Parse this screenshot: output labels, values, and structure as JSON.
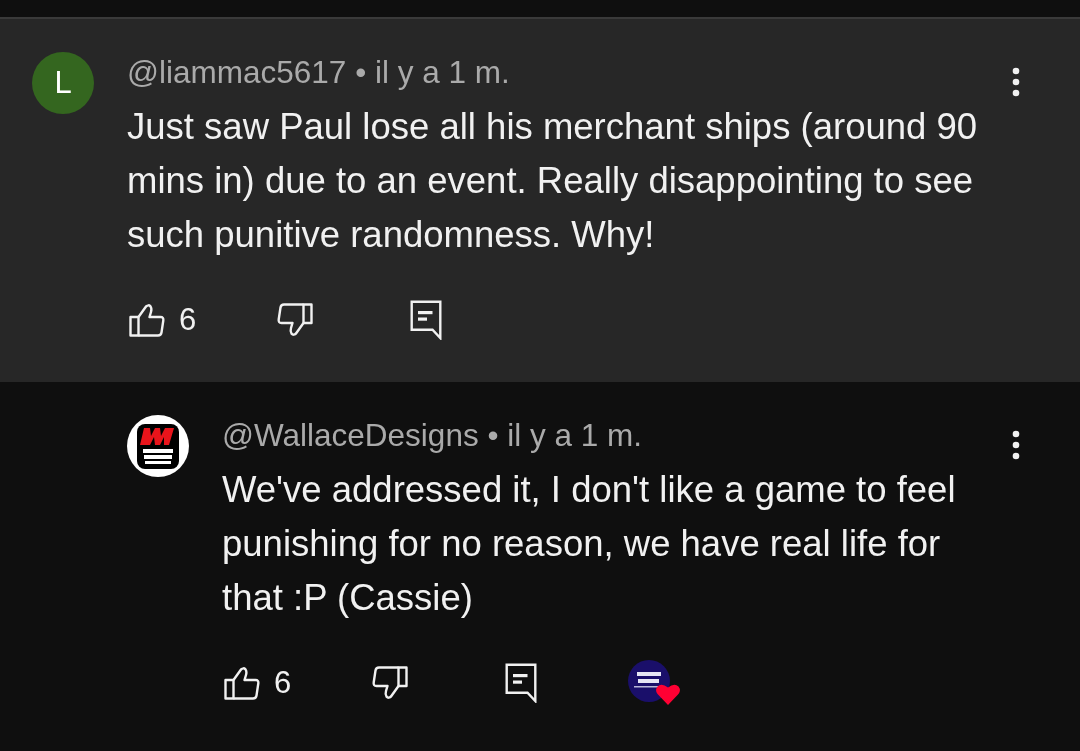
{
  "comments": [
    {
      "avatar": {
        "kind": "letter",
        "letter": "L",
        "color": "#34661f"
      },
      "author": "@liammac5617",
      "time": "• il y a 1 m.",
      "text": "Just saw Paul lose all his merchant ships (around 90 mins in) due to an event. Really disappointing to see such punitive randomness. Why!",
      "likes": "6",
      "highlighted": true,
      "replies": [
        {
          "avatar": {
            "kind": "logo"
          },
          "author": "@WallaceDesigns",
          "time": "• il y a 1 m.",
          "text": "We've addressed it, I don't like a game to feel punishing for no reason, we have real life for that :P (Cassie)",
          "likes": "6",
          "creator_heart": true
        }
      ]
    }
  ]
}
